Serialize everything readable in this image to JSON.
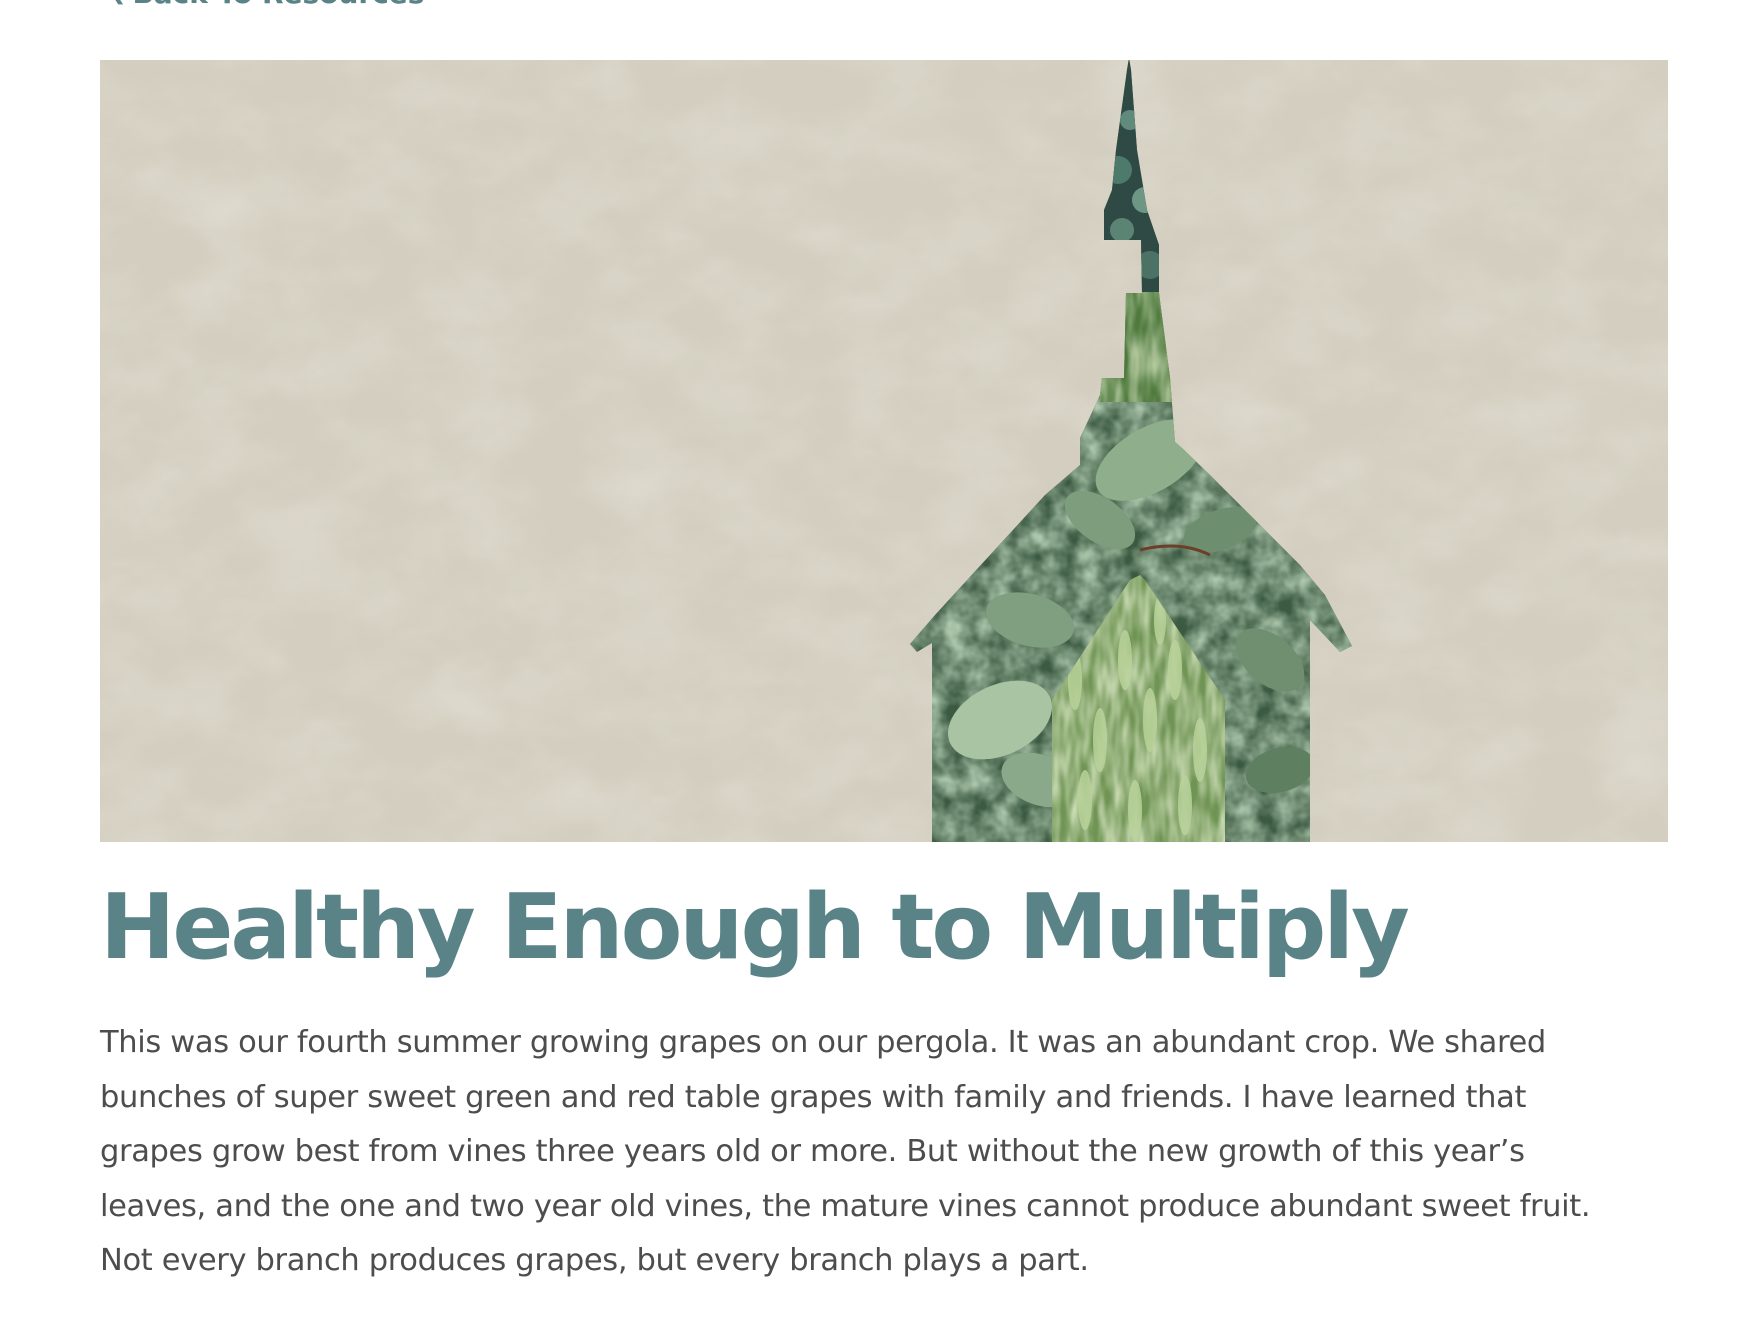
{
  "nav": {
    "back_label": "Back To Resources",
    "back_icon": "chevron-left-icon"
  },
  "hero": {
    "image_icon": "church-steeple-leaf-collage-illustration",
    "background_color": "#d3cebf",
    "accent_greens": [
      "#3f5d44",
      "#6f8f6d",
      "#9bbd78"
    ]
  },
  "article": {
    "title": "Healthy Enough to Multiply",
    "title_color": "#5a8388",
    "body_lines": [
      "This was our fourth summer growing grapes on our pergola. It was an abundant crop. We shared",
      "bunches of super sweet green and red table grapes with family and friends. I have learned that",
      "grapes grow best from vines three years old or more. But without the new growth of this year’s",
      "leaves, and the one and two year old vines, the mature vines cannot produce abundant sweet fruit.",
      "Not every branch produces grapes, but every branch plays a part."
    ],
    "text_color": "#4d4d4d"
  }
}
